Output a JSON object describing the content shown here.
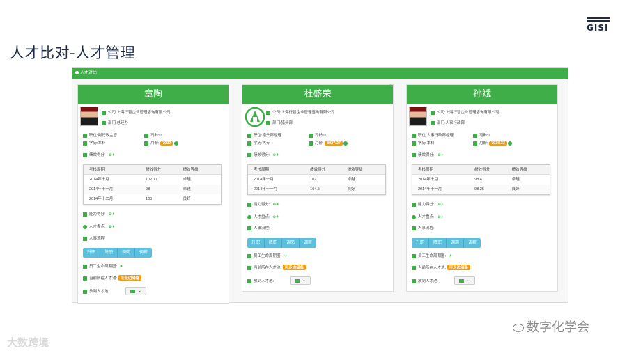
{
  "slide": {
    "title": "人才比对-人才管理",
    "logo": "GISI"
  },
  "panel": {
    "header": "人才对比"
  },
  "labels": {
    "company": "公司:",
    "dept": "部门:",
    "position": "职位:",
    "tenure": "司龄:",
    "education": "学历:",
    "salary": "月薪:",
    "performance": "绩效得分:",
    "ability": "能力得分:",
    "talent_map": "人才盘点:",
    "hr_flow": "人事流程:",
    "lifecycle": "员工生命周期图:",
    "current_pool": "当前所在人才池:",
    "move_pool": "放到人才池:",
    "grid_headers": [
      "考核周期",
      "绩效得分",
      "绩效等级"
    ]
  },
  "actions": [
    "升职",
    "降职",
    "调岗",
    "调薪"
  ],
  "cards": [
    {
      "name": "章陶",
      "company": "上海行智企业管理咨询有限公司",
      "dept": "总经办",
      "position": "副行政主管",
      "tenure": "0",
      "education": "本科",
      "salary": "7920",
      "performance": [
        [
          "2014年十月",
          "102.17",
          "卓越"
        ],
        [
          "2014年十一月",
          "98",
          "卓越"
        ],
        [
          "2014年十二月",
          "100",
          "良好"
        ]
      ],
      "pool": "可走边储备"
    },
    {
      "name": "杜盛荣",
      "company": "上海行智企业管理咨询有限公司",
      "dept": "猎头部",
      "position": "猎头部经理",
      "tenure": "0",
      "education": "大专",
      "salary": "8927.27",
      "performance": [
        [
          "2014年十月",
          "107",
          "卓越"
        ],
        [
          "2014年十一月",
          "104.5",
          "良好"
        ]
      ],
      "pool": "可走边储备"
    },
    {
      "name": "孙斌",
      "company": "上海行智企业管理咨询有限公司",
      "dept": "人事行政部",
      "position": "人事行政部经理",
      "tenure": "1",
      "education": "本科",
      "salary": "7936.33",
      "performance": [
        [
          "2014年十月",
          "98.4",
          "卓越"
        ],
        [
          "2014年十一月",
          "98.25",
          "良好"
        ]
      ],
      "pool": "可走边储备"
    }
  ],
  "watermarks": {
    "left": "大数跨境",
    "right": "数字化学会"
  }
}
